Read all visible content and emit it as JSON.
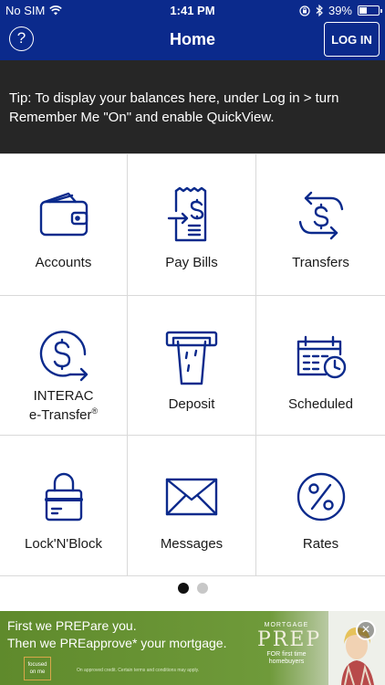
{
  "status_bar": {
    "carrier": "No SIM",
    "time": "1:41 PM",
    "battery": "39%",
    "battery_level": 0.39
  },
  "nav": {
    "title": "Home",
    "help_label": "?",
    "login_label": "LOG IN"
  },
  "tip": {
    "text": "Tip: To display your balances here, under Log in > turn Remember Me \"On\" and enable QuickView."
  },
  "tiles": [
    {
      "label": "Accounts",
      "icon": "wallet-icon"
    },
    {
      "label": "Pay Bills",
      "icon": "bill-icon"
    },
    {
      "label": "Transfers",
      "icon": "transfer-icon"
    },
    {
      "label_line1": "INTERAC",
      "label_line2": "e-Transfer",
      "label_sup": "®",
      "icon": "etransfer-icon"
    },
    {
      "label": "Deposit",
      "icon": "atm-deposit-icon"
    },
    {
      "label": "Scheduled",
      "icon": "calendar-clock-icon"
    },
    {
      "label": "Lock'N'Block",
      "icon": "lock-card-icon"
    },
    {
      "label": "Messages",
      "icon": "envelope-icon"
    },
    {
      "label": "Rates",
      "icon": "percent-icon"
    }
  ],
  "pager": {
    "total": 2,
    "active": 1
  },
  "ad": {
    "line1": "First we PREPare you.",
    "line2": "Then we PREapprove* your mortgage.",
    "logo_text": "focused on me",
    "fine_print": "On approved credit. Certain terms and conditions may apply.",
    "brand_top": "MORTGAGE",
    "brand_main": "PREP",
    "brand_caption": "FOR first time homebuyers",
    "close_label": "×"
  },
  "colors": {
    "header": "#0b2a8c",
    "icon": "#0b2a8c",
    "tip_bg": "#262626",
    "ad_green": "#6f9a3a"
  }
}
